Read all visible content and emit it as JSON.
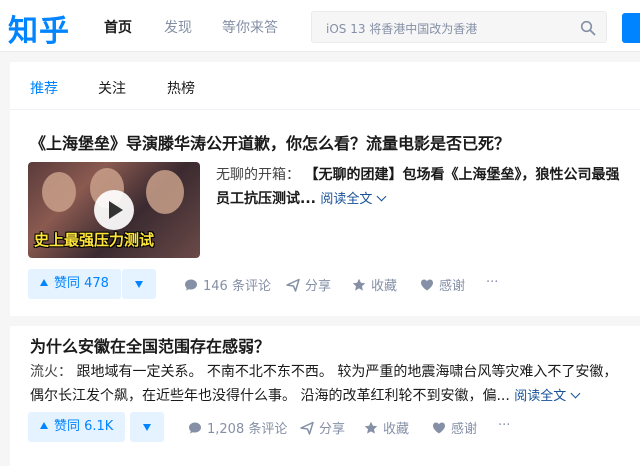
{
  "header": {
    "logo": "知乎",
    "nav": [
      {
        "label": "首页"
      },
      {
        "label": "发现"
      },
      {
        "label": "等你来答"
      }
    ],
    "search_placeholder": "iOS 13 将香港中国改为香港",
    "search_icon": "search-icon"
  },
  "tabs": [
    {
      "label": "推荐"
    },
    {
      "label": "关注"
    },
    {
      "label": "热榜"
    }
  ],
  "feed": [
    {
      "title": "《上海堡垒》导演滕华涛公开道歉，你怎么看？流量电影是否已死？",
      "thumbnail_caption": "史上最强压力测试",
      "author": "无聊的开箱：",
      "excerpt": "【无聊的团建】包场看《上海堡垒》，狼性公司最强员工抗压测试...",
      "read_more": "阅读全文",
      "votes": "赞同 478",
      "comments": "146 条评论",
      "share": "分享",
      "favorite": "收藏",
      "thanks": "感谢",
      "more": "···"
    },
    {
      "title": "为什么安徽在全国范围存在感弱？",
      "author": "流火：",
      "excerpt": "跟地域有一定关系。 不南不北不东不西。 较为严重的地震海啸台风等灾难入不了安徽，偶尔长江发个飙，在近些年也没得什么事。 沿海的改革红利轮不到安徽，偏...",
      "read_more": "阅读全文",
      "votes": "赞同 6.1K",
      "comments": "1,208 条评论",
      "share": "分享",
      "favorite": "收藏",
      "thanks": "感谢",
      "more": "···"
    }
  ],
  "colors": {
    "brand": "#0084ff",
    "link": "#175199",
    "muted": "#8590a6"
  }
}
